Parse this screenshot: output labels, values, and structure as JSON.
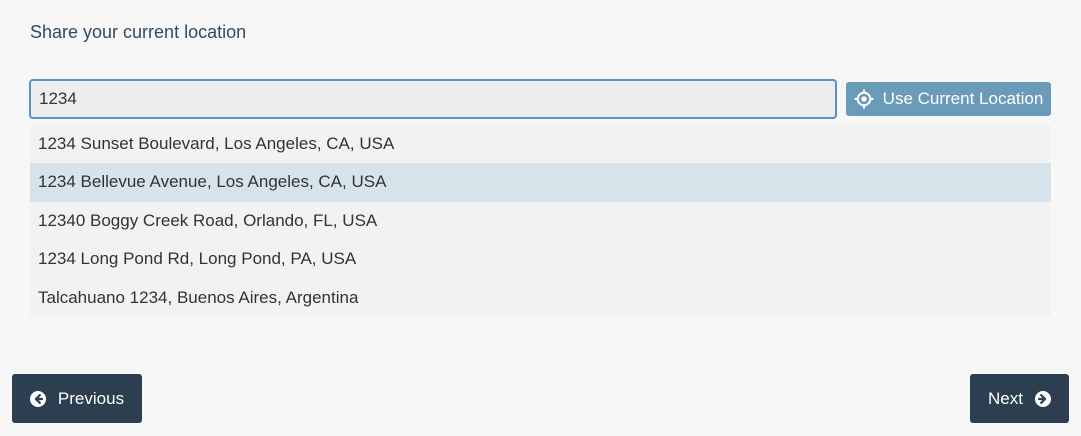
{
  "page": {
    "title": "Share your current location"
  },
  "search": {
    "value": "1234",
    "button_label": "Use Current Location",
    "button_icon": "crosshair-icon"
  },
  "suggestions": [
    {
      "label": "1234 Sunset Boulevard, Los Angeles, CA, USA",
      "active": false
    },
    {
      "label": "1234 Bellevue Avenue, Los Angeles, CA, USA",
      "active": true
    },
    {
      "label": "12340 Boggy Creek Road, Orlando, FL, USA",
      "active": false
    },
    {
      "label": "1234 Long Pond Rd, Long Pond, PA, USA",
      "active": false
    },
    {
      "label": "Talcahuano 1234, Buenos Aires, Argentina",
      "active": false
    }
  ],
  "navigation": {
    "previous_label": "Previous",
    "previous_icon": "arrow-circle-left-icon",
    "next_label": "Next",
    "next_icon": "arrow-circle-right-icon"
  },
  "colors": {
    "accent": "#6a9bb8",
    "nav_button": "#2c3e50",
    "active_suggestion": "#d6e3eb",
    "input_border": "#5b8fc7"
  }
}
